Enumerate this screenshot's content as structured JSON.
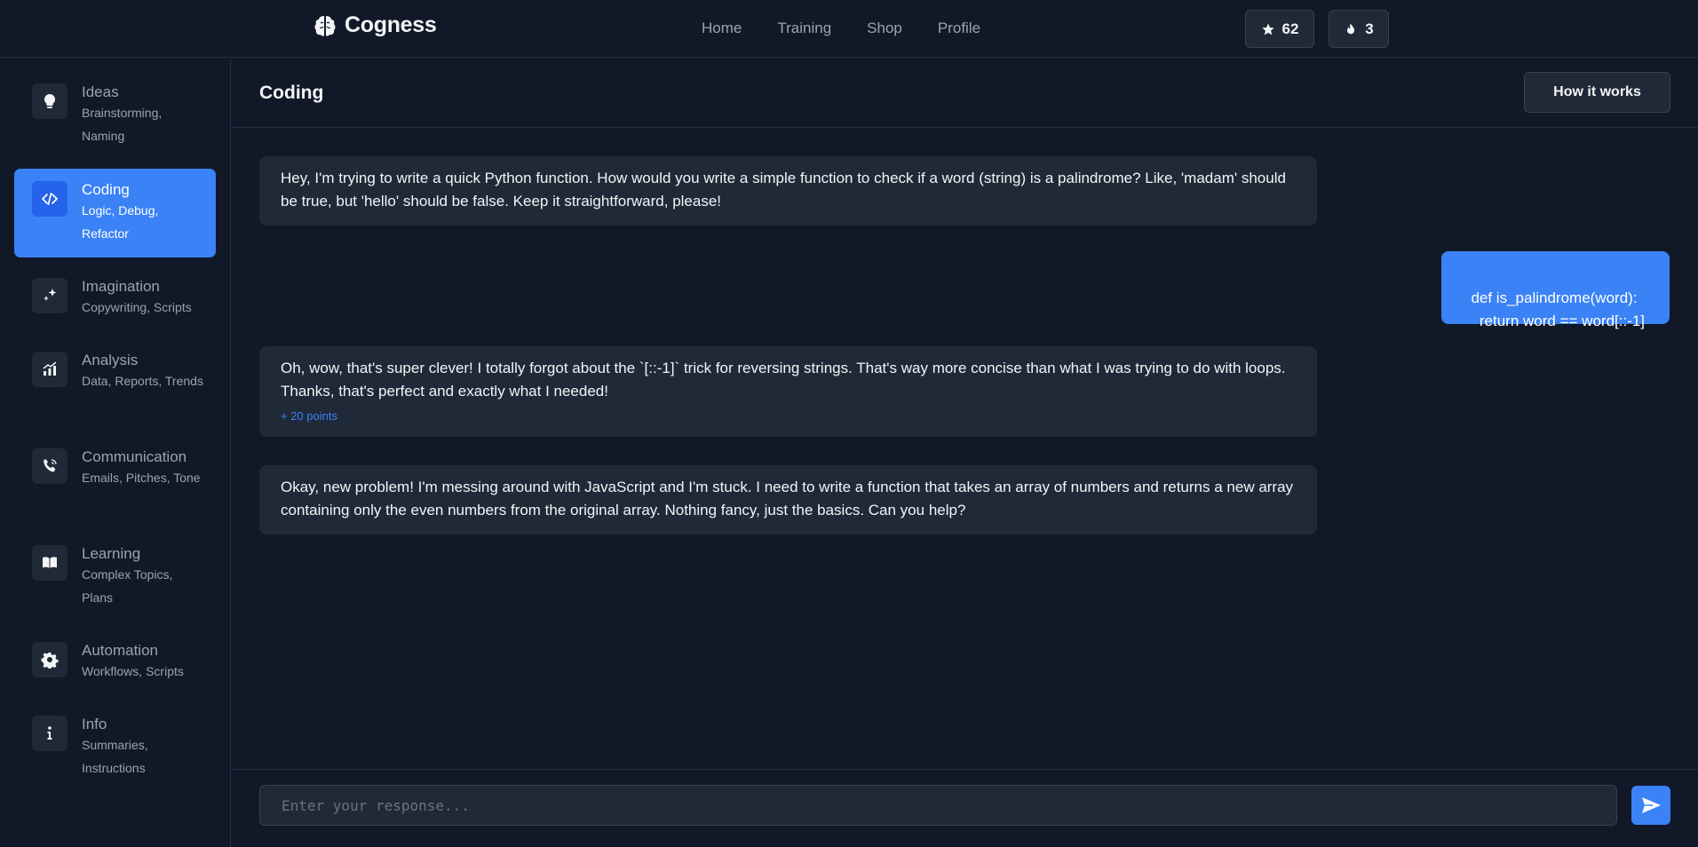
{
  "header": {
    "brand": "Cogness",
    "nav": [
      "Home",
      "Training",
      "Shop",
      "Profile"
    ],
    "points": "62",
    "streak": "3"
  },
  "sidebar": {
    "items": [
      {
        "title": "Ideas",
        "subtitle": "Brainstorming, Naming",
        "icon": "lightbulb-icon",
        "active": false
      },
      {
        "title": "Coding",
        "subtitle": "Logic, Debug, Refactor",
        "icon": "code-icon",
        "active": true
      },
      {
        "title": "Imagination",
        "subtitle": "Copywriting, Scripts",
        "icon": "sparkles-icon",
        "active": false
      },
      {
        "title": "Analysis",
        "subtitle": "Data, Reports, Trends",
        "icon": "chart-icon",
        "active": false
      },
      {
        "title": "Communication",
        "subtitle": "Emails, Pitches, Tone",
        "icon": "phone-icon",
        "active": false
      },
      {
        "title": "Learning",
        "subtitle": "Complex Topics, Plans",
        "icon": "book-icon",
        "active": false
      },
      {
        "title": "Automation",
        "subtitle": "Workflows, Scripts",
        "icon": "gear-icon",
        "active": false
      },
      {
        "title": "Info",
        "subtitle": "Summaries, Instructions",
        "icon": "info-icon",
        "active": false
      }
    ]
  },
  "main": {
    "title": "Coding",
    "how_it_works": "How it works",
    "messages": [
      {
        "side": "left",
        "text": "Hey, I'm trying to write a quick Python function. How would you write a simple function to check if a word (string) is a palindrome? Like, 'madam' should be true, but 'hello' should be false. Keep it straightforward, please!"
      },
      {
        "side": "right",
        "text": "def is_palindrome(word):\n    return word == word[::-1]"
      },
      {
        "side": "left",
        "text": "Oh, wow, that's super clever! I totally forgot about the `[::-1]` trick for reversing strings. That's way more concise than what I was trying to do with loops. Thanks, that's perfect and exactly what I needed!",
        "points": "+ 20 points"
      },
      {
        "side": "left",
        "text": "Okay, new problem! I'm messing around with JavaScript and I'm stuck. I need to write a function that takes an array of numbers and returns a new array containing only the even numbers from the original array. Nothing fancy, just the basics. Can you help?"
      }
    ]
  },
  "input": {
    "placeholder": "Enter your response...",
    "value": ""
  },
  "colors": {
    "background": "#111827",
    "panel": "#1f2937",
    "accent": "#3b82f6",
    "muted_text": "#9ca3af"
  }
}
